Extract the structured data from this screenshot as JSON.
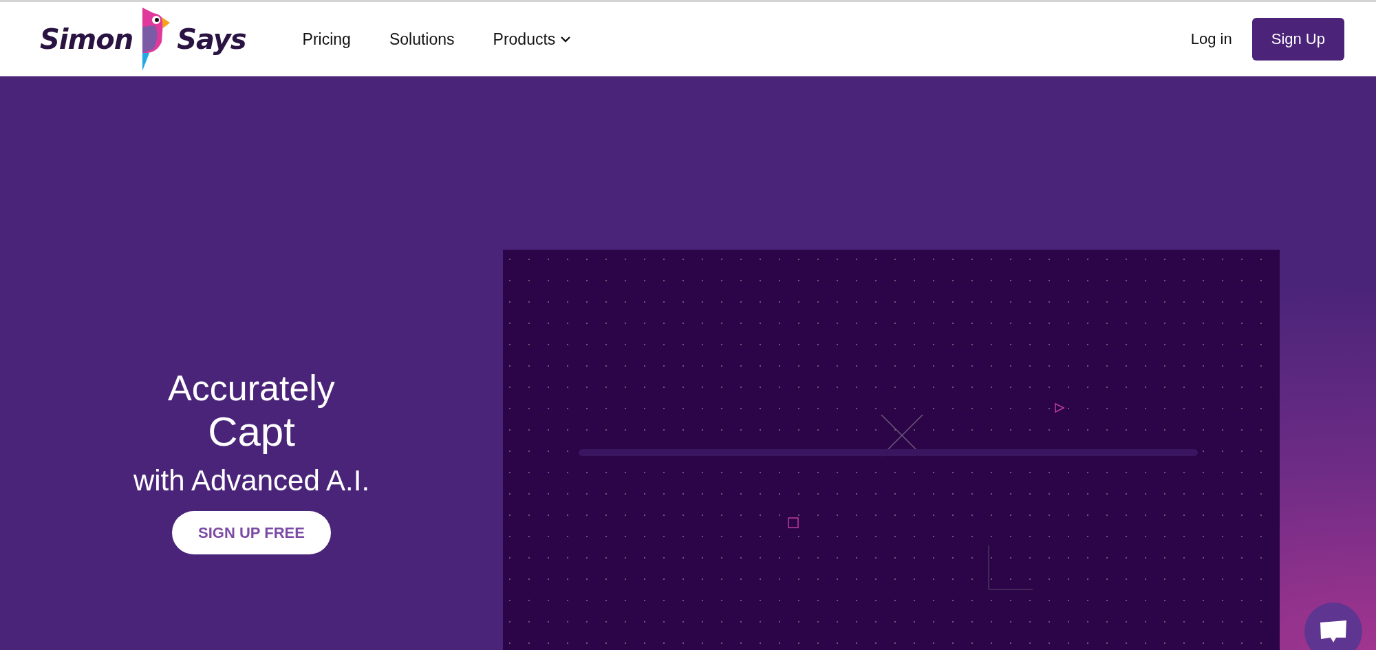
{
  "header": {
    "logo": {
      "left": "Simon",
      "right": "Says"
    },
    "nav": [
      {
        "label": "Pricing",
        "dropdown": false
      },
      {
        "label": "Solutions",
        "dropdown": false
      },
      {
        "label": "Products",
        "dropdown": true
      }
    ],
    "login": "Log in",
    "signup": "Sign Up"
  },
  "hero": {
    "headline_lines": [
      "Accurately",
      "Capt",
      "with Advanced A.I."
    ],
    "cta": "SIGN UP FREE"
  }
}
